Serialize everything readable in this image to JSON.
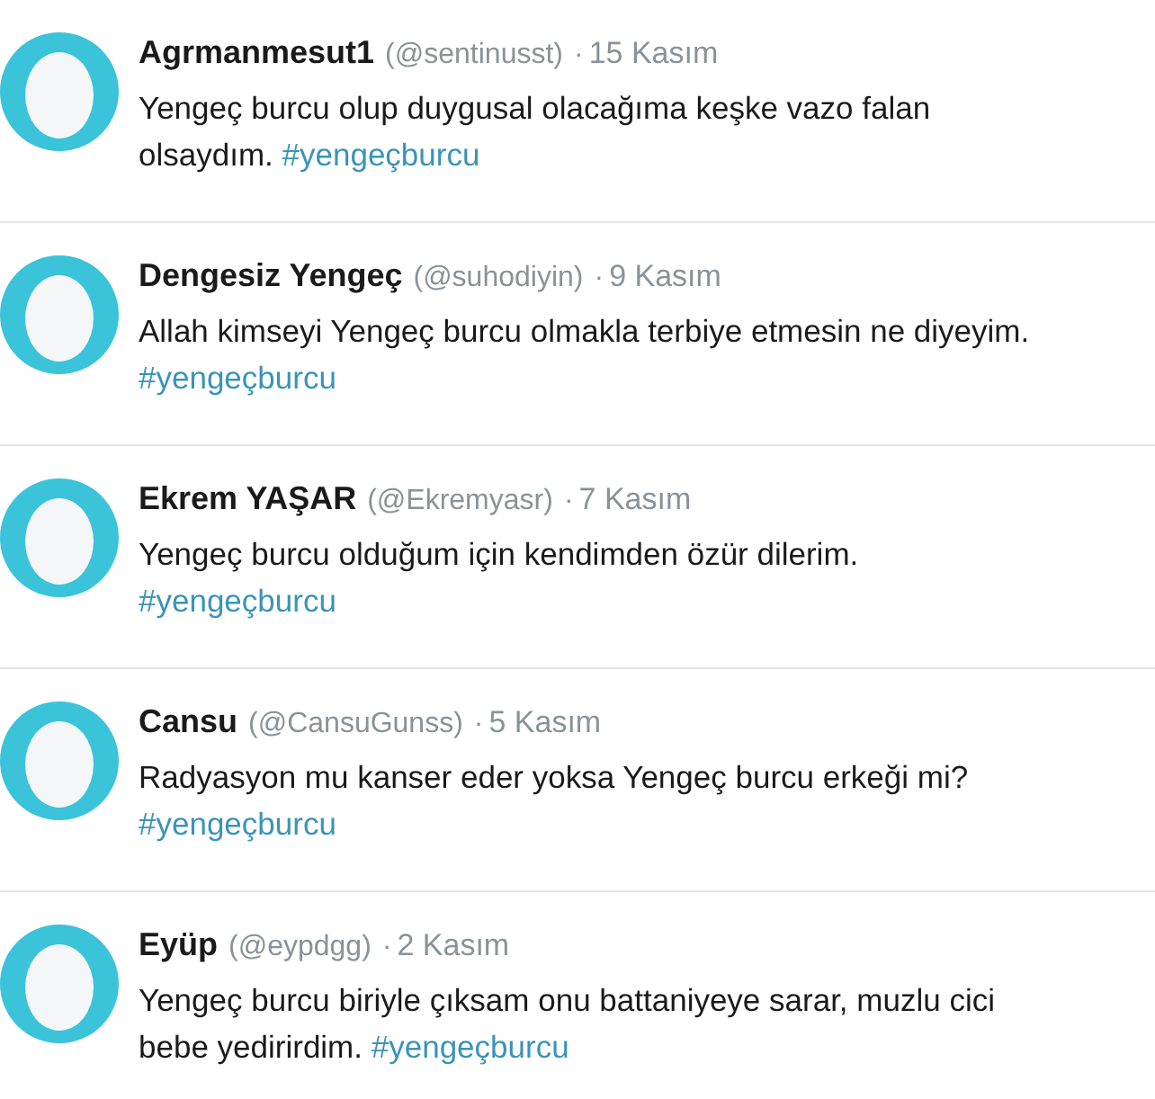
{
  "tweets": [
    {
      "name": "Agrmanmesut1",
      "handle": "(@sentinusst)",
      "separator": "·",
      "date": "15 Kasım",
      "text": "Yengeç burcu olup duygusal olacağıma keşke vazo falan olsaydım.",
      "hashtag": "#yengeçburcu"
    },
    {
      "name": "Dengesiz Yengeç",
      "handle": "(@suhodiyin)",
      "separator": "·",
      "date": "9 Kasım",
      "text": "Allah kimseyi Yengeç burcu olmakla terbiye etmesin ne diyeyim.",
      "hashtag": "#yengeçburcu"
    },
    {
      "name": "Ekrem YAŞAR",
      "handle": "(@Ekremyasr)",
      "separator": "·",
      "date": "7 Kasım",
      "text": "Yengeç burcu olduğum için kendimden özür dilerim.",
      "hashtag": "#yengeçburcu"
    },
    {
      "name": "Cansu",
      "handle": "(@CansuGunss)",
      "separator": "·",
      "date": "5 Kasım",
      "text": "Radyasyon mu kanser eder yoksa Yengeç burcu erkeği mi?",
      "hashtag": "#yengeçburcu"
    },
    {
      "name": "Eyüp",
      "handle": "(@eypdgg)",
      "separator": "·",
      "date": "2 Kasım",
      "text": "Yengeç burcu biriyle çıksam onu battaniyeye sarar, muzlu cici bebe yedirirdim.",
      "hashtag": "#yengeçburcu"
    }
  ]
}
